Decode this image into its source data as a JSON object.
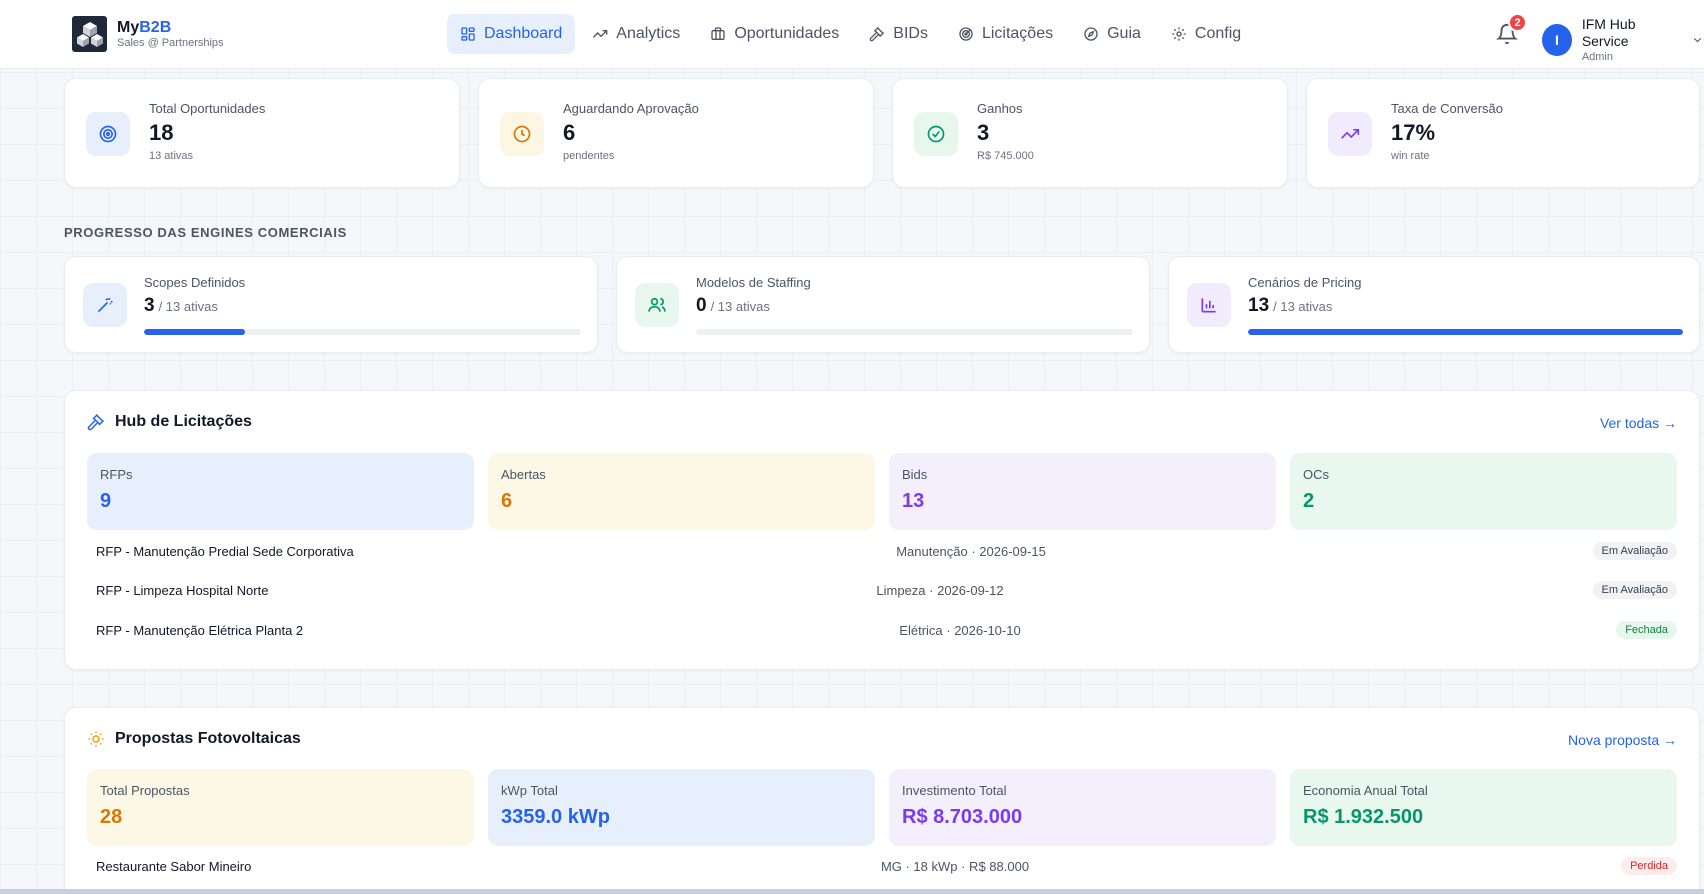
{
  "brand": {
    "name_prefix": "My",
    "name_accent": "B2B",
    "subtitle": "Sales @ Partnerships"
  },
  "nav": [
    {
      "label": "Dashboard",
      "icon": "dashboard-icon",
      "active": true
    },
    {
      "label": "Analytics",
      "icon": "trending-up-icon"
    },
    {
      "label": "Oportunidades",
      "icon": "briefcase-icon"
    },
    {
      "label": "BIDs",
      "icon": "gavel-icon"
    },
    {
      "label": "Licitações",
      "icon": "radar-icon"
    },
    {
      "label": "Guia",
      "icon": "compass-icon"
    },
    {
      "label": "Config",
      "icon": "gear-icon"
    }
  ],
  "notifications": {
    "count": "2"
  },
  "user": {
    "initial": "I",
    "name": "IFM Hub Service",
    "role": "Admin"
  },
  "kpis": [
    {
      "label": "Total Oportunidades",
      "value": "18",
      "sub": "13 ativas",
      "icon": "target-icon",
      "color": "#2563eb",
      "bg": "#e8effc"
    },
    {
      "label": "Aguardando Aprovação",
      "value": "6",
      "sub": "pendentes",
      "icon": "clock-icon",
      "color": "#d97706",
      "bg": "#fdf6e3"
    },
    {
      "label": "Ganhos",
      "value": "3",
      "sub": "R$ 745.000",
      "icon": "check-circle-icon",
      "color": "#059669",
      "bg": "#e7f7ee"
    },
    {
      "label": "Taxa de Conversão",
      "value": "17%",
      "sub": "win rate",
      "icon": "trending-up-icon",
      "color": "#7c3aed",
      "bg": "#f1ecfd"
    }
  ],
  "engines": {
    "section_title": "PROGRESSO DAS ENGINES COMERCIAIS",
    "items": [
      {
        "label": "Scopes Definidos",
        "value": "3",
        "total": "/ 13 ativas",
        "progress": 0.23,
        "icon": "magic-wand-icon",
        "color": "#2563eb",
        "bg": "#e8effc"
      },
      {
        "label": "Modelos de Staffing",
        "value": "0",
        "total": "/ 13 ativas",
        "progress": 0,
        "icon": "users-icon",
        "color": "#059669",
        "bg": "#e7f7ee"
      },
      {
        "label": "Cenários de Pricing",
        "value": "13",
        "total": "/ 13 ativas",
        "progress": 1,
        "icon": "bar-chart-icon",
        "color": "#7c3aed",
        "bg": "#f1ecfd"
      }
    ]
  },
  "licitacoes": {
    "title": "Hub de Licitações",
    "link": "Ver todas →",
    "stats": [
      {
        "label": "RFPs",
        "value": "9",
        "color": "#2563eb",
        "bg": "#e8effc"
      },
      {
        "label": "Abertas",
        "value": "6",
        "color": "#d97706",
        "bg": "#fdf8e6"
      },
      {
        "label": "Bids",
        "value": "13",
        "color": "#7c3aed",
        "bg": "#f3effc"
      },
      {
        "label": "OCs",
        "value": "2",
        "color": "#059669",
        "bg": "#e9f8ef"
      }
    ],
    "rows": [
      {
        "title": "RFP - Manutenção Predial Sede Corporativa",
        "meta": "Manutenção · 2026-09-15",
        "status": "Em Avaliação",
        "tone": "gray"
      },
      {
        "title": "RFP - Limpeza Hospital Norte",
        "meta": "Limpeza · 2026-09-12",
        "status": "Em Avaliação",
        "tone": "gray"
      },
      {
        "title": "RFP - Manutenção Elétrica Planta 2",
        "meta": "Elétrica · 2026-10-10",
        "status": "Fechada",
        "tone": "green"
      }
    ]
  },
  "fotovoltaicas": {
    "title": "Propostas Fotovoltaicas",
    "link": "Nova proposta →",
    "stats": [
      {
        "label": "Total Propostas",
        "value": "28",
        "color": "#d97706",
        "bg": "#fdf8e6"
      },
      {
        "label": "kWp Total",
        "value": "3359.0 kWp",
        "color": "#2563eb",
        "bg": "#e8effc"
      },
      {
        "label": "Investimento Total",
        "value": "R$ 8.703.000",
        "color": "#7c3aed",
        "bg": "#f3effc"
      },
      {
        "label": "Economia Anual Total",
        "value": "R$ 1.932.500",
        "color": "#059669",
        "bg": "#e9f8ef"
      }
    ],
    "rows": [
      {
        "title": "Restaurante Sabor Mineiro",
        "meta": "MG · 18 kWp · R$ 88.000",
        "status": "Perdida",
        "tone": "red"
      }
    ]
  }
}
